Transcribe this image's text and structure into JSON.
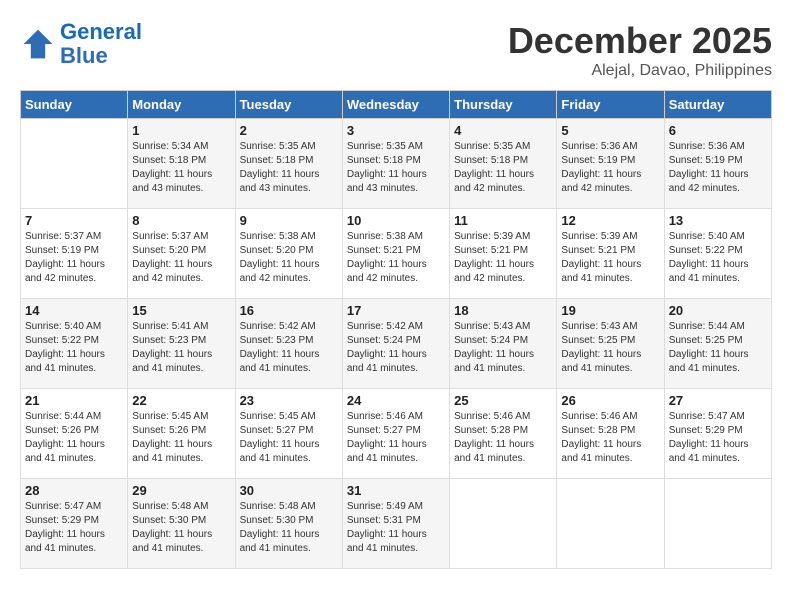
{
  "header": {
    "logo_line1": "General",
    "logo_line2": "Blue",
    "month": "December 2025",
    "location": "Alejal, Davao, Philippines"
  },
  "weekdays": [
    "Sunday",
    "Monday",
    "Tuesday",
    "Wednesday",
    "Thursday",
    "Friday",
    "Saturday"
  ],
  "weeks": [
    [
      {
        "day": "",
        "info": ""
      },
      {
        "day": "1",
        "info": "Sunrise: 5:34 AM\nSunset: 5:18 PM\nDaylight: 11 hours and 43 minutes."
      },
      {
        "day": "2",
        "info": "Sunrise: 5:35 AM\nSunset: 5:18 PM\nDaylight: 11 hours and 43 minutes."
      },
      {
        "day": "3",
        "info": "Sunrise: 5:35 AM\nSunset: 5:18 PM\nDaylight: 11 hours and 43 minutes."
      },
      {
        "day": "4",
        "info": "Sunrise: 5:35 AM\nSunset: 5:18 PM\nDaylight: 11 hours and 42 minutes."
      },
      {
        "day": "5",
        "info": "Sunrise: 5:36 AM\nSunset: 5:19 PM\nDaylight: 11 hours and 42 minutes."
      },
      {
        "day": "6",
        "info": "Sunrise: 5:36 AM\nSunset: 5:19 PM\nDaylight: 11 hours and 42 minutes."
      }
    ],
    [
      {
        "day": "7",
        "info": "Sunrise: 5:37 AM\nSunset: 5:19 PM\nDaylight: 11 hours and 42 minutes."
      },
      {
        "day": "8",
        "info": "Sunrise: 5:37 AM\nSunset: 5:20 PM\nDaylight: 11 hours and 42 minutes."
      },
      {
        "day": "9",
        "info": "Sunrise: 5:38 AM\nSunset: 5:20 PM\nDaylight: 11 hours and 42 minutes."
      },
      {
        "day": "10",
        "info": "Sunrise: 5:38 AM\nSunset: 5:21 PM\nDaylight: 11 hours and 42 minutes."
      },
      {
        "day": "11",
        "info": "Sunrise: 5:39 AM\nSunset: 5:21 PM\nDaylight: 11 hours and 42 minutes."
      },
      {
        "day": "12",
        "info": "Sunrise: 5:39 AM\nSunset: 5:21 PM\nDaylight: 11 hours and 41 minutes."
      },
      {
        "day": "13",
        "info": "Sunrise: 5:40 AM\nSunset: 5:22 PM\nDaylight: 11 hours and 41 minutes."
      }
    ],
    [
      {
        "day": "14",
        "info": "Sunrise: 5:40 AM\nSunset: 5:22 PM\nDaylight: 11 hours and 41 minutes."
      },
      {
        "day": "15",
        "info": "Sunrise: 5:41 AM\nSunset: 5:23 PM\nDaylight: 11 hours and 41 minutes."
      },
      {
        "day": "16",
        "info": "Sunrise: 5:42 AM\nSunset: 5:23 PM\nDaylight: 11 hours and 41 minutes."
      },
      {
        "day": "17",
        "info": "Sunrise: 5:42 AM\nSunset: 5:24 PM\nDaylight: 11 hours and 41 minutes."
      },
      {
        "day": "18",
        "info": "Sunrise: 5:43 AM\nSunset: 5:24 PM\nDaylight: 11 hours and 41 minutes."
      },
      {
        "day": "19",
        "info": "Sunrise: 5:43 AM\nSunset: 5:25 PM\nDaylight: 11 hours and 41 minutes."
      },
      {
        "day": "20",
        "info": "Sunrise: 5:44 AM\nSunset: 5:25 PM\nDaylight: 11 hours and 41 minutes."
      }
    ],
    [
      {
        "day": "21",
        "info": "Sunrise: 5:44 AM\nSunset: 5:26 PM\nDaylight: 11 hours and 41 minutes."
      },
      {
        "day": "22",
        "info": "Sunrise: 5:45 AM\nSunset: 5:26 PM\nDaylight: 11 hours and 41 minutes."
      },
      {
        "day": "23",
        "info": "Sunrise: 5:45 AM\nSunset: 5:27 PM\nDaylight: 11 hours and 41 minutes."
      },
      {
        "day": "24",
        "info": "Sunrise: 5:46 AM\nSunset: 5:27 PM\nDaylight: 11 hours and 41 minutes."
      },
      {
        "day": "25",
        "info": "Sunrise: 5:46 AM\nSunset: 5:28 PM\nDaylight: 11 hours and 41 minutes."
      },
      {
        "day": "26",
        "info": "Sunrise: 5:46 AM\nSunset: 5:28 PM\nDaylight: 11 hours and 41 minutes."
      },
      {
        "day": "27",
        "info": "Sunrise: 5:47 AM\nSunset: 5:29 PM\nDaylight: 11 hours and 41 minutes."
      }
    ],
    [
      {
        "day": "28",
        "info": "Sunrise: 5:47 AM\nSunset: 5:29 PM\nDaylight: 11 hours and 41 minutes."
      },
      {
        "day": "29",
        "info": "Sunrise: 5:48 AM\nSunset: 5:30 PM\nDaylight: 11 hours and 41 minutes."
      },
      {
        "day": "30",
        "info": "Sunrise: 5:48 AM\nSunset: 5:30 PM\nDaylight: 11 hours and 41 minutes."
      },
      {
        "day": "31",
        "info": "Sunrise: 5:49 AM\nSunset: 5:31 PM\nDaylight: 11 hours and 41 minutes."
      },
      {
        "day": "",
        "info": ""
      },
      {
        "day": "",
        "info": ""
      },
      {
        "day": "",
        "info": ""
      }
    ]
  ]
}
